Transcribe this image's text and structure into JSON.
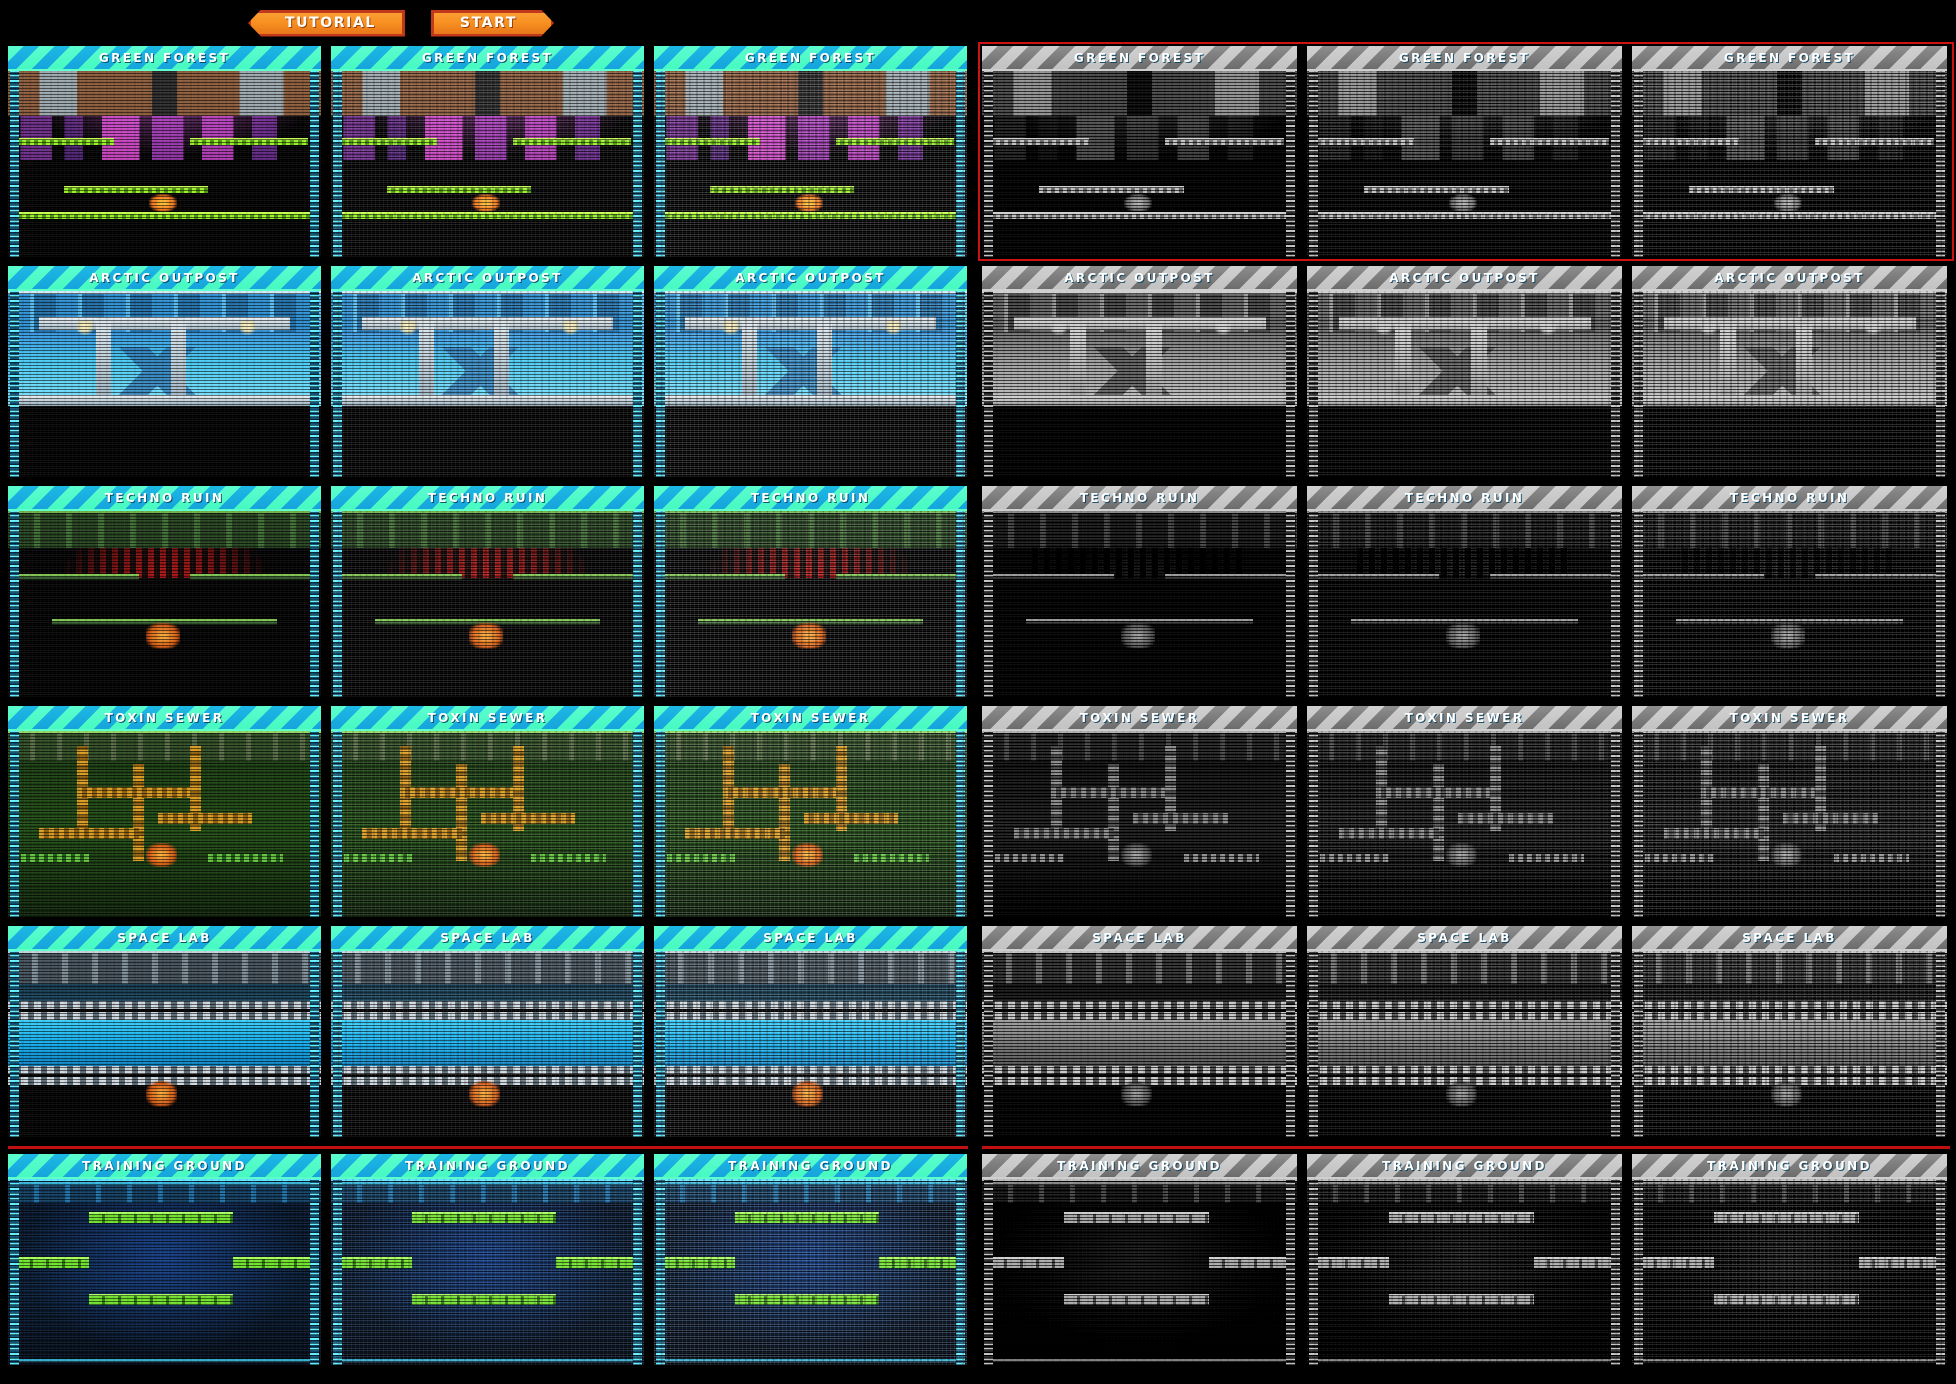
{
  "topbar": {
    "tutorial_label": "TUTORIAL",
    "start_label": "START",
    "accent_color": "#f78f20",
    "accent_border": "#c0391a"
  },
  "theme": {
    "background": "#000000",
    "banner_cyan": "#1fb8dd",
    "banner_green": "#5effc8",
    "highlight_red": "#cc1212",
    "label_color": "#ffffff"
  },
  "levels": [
    {
      "name": "GREEN FOREST",
      "scene": "forest"
    },
    {
      "name": "ARCTIC OUTPOST",
      "scene": "arctic"
    },
    {
      "name": "TECHNO RUIN",
      "scene": "techno"
    },
    {
      "name": "TOXIN SEWER",
      "scene": "toxin"
    },
    {
      "name": "SPACE LAB",
      "scene": "space"
    },
    {
      "name": "TRAINING GROUND",
      "scene": "train"
    }
  ],
  "variants": {
    "color_count": 3,
    "gray_count": 3,
    "noise_levels": [
      "noise-lite",
      "noise-mid",
      "noise-hi"
    ]
  },
  "annotations": {
    "highlighted_row": "GREEN FOREST",
    "highlight_panel": "grayscale",
    "separator_before": "TRAINING GROUND"
  }
}
